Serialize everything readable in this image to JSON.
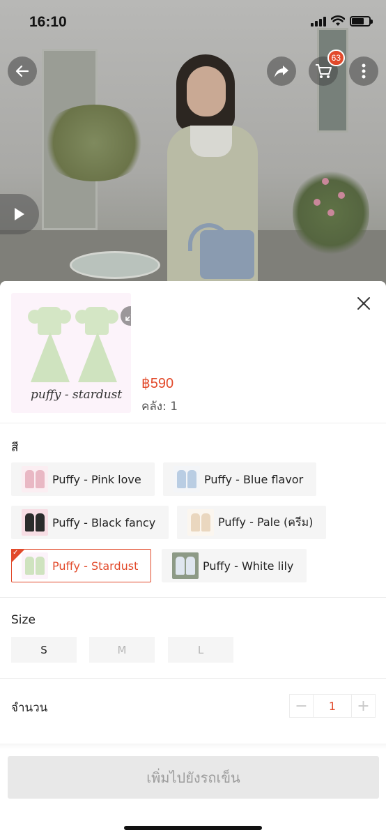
{
  "status_bar": {
    "time": "16:10"
  },
  "header": {
    "cart_count": "63"
  },
  "product": {
    "price": "฿590",
    "stock": "คลัง: 1",
    "thumbnail_caption": "puffy - stardust"
  },
  "color_section": {
    "title": "สี",
    "options": [
      {
        "label": "Puffy - Pink love",
        "swatch": "#e9b8c4",
        "selected": false
      },
      {
        "label": "Puffy - Blue flavor",
        "swatch": "#b9cde3",
        "selected": false
      },
      {
        "label": "Puffy - Black fancy",
        "swatch": "#2b2b2b",
        "selected": false
      },
      {
        "label": "Puffy - Pale (ครีม)",
        "swatch": "#ead7bf",
        "selected": false
      },
      {
        "label": "Puffy - Stardust",
        "swatch": "#cfe3bf",
        "selected": true
      },
      {
        "label": "Puffy - White lily",
        "swatch": "#dfe6ef",
        "selected": false
      }
    ]
  },
  "size_section": {
    "title": "Size",
    "options": [
      {
        "label": "S",
        "available": true
      },
      {
        "label": "M",
        "available": false
      },
      {
        "label": "L",
        "available": false
      }
    ]
  },
  "quantity": {
    "label": "จำนวน",
    "value": "1",
    "minus": "−",
    "plus": "+"
  },
  "add_to_cart_label": "เพิ่มไปยังรถเข็น",
  "colors": {
    "accent": "#e24a2b",
    "disabled_bg": "#e8e8e8",
    "disabled_text": "#9b9b9b"
  }
}
